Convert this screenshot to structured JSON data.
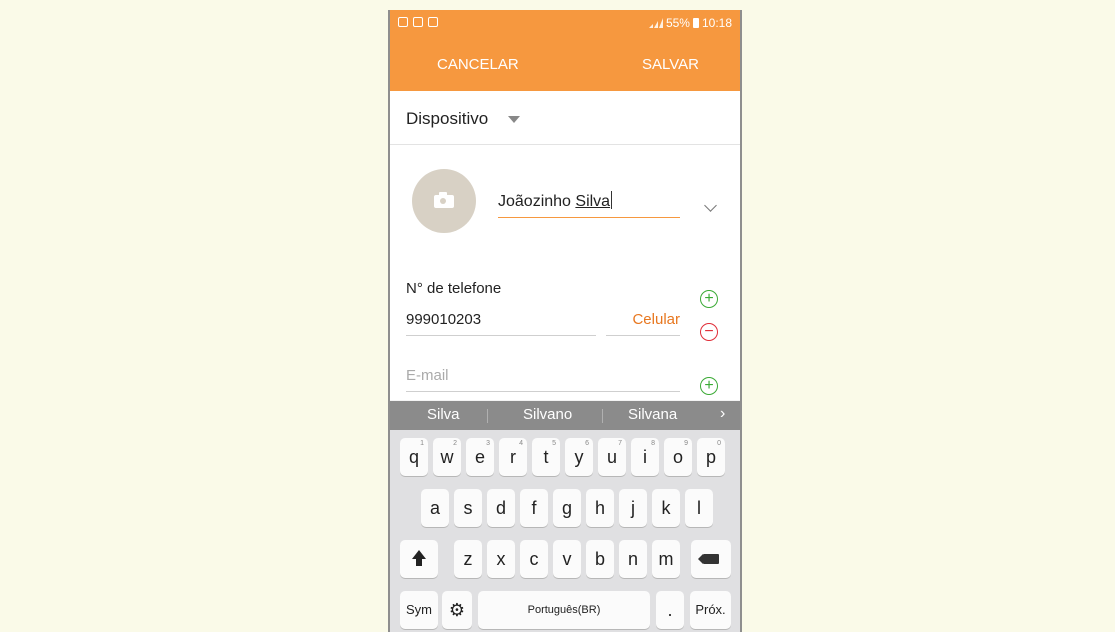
{
  "status_bar": {
    "battery": "55%",
    "time": "10:18"
  },
  "actions": {
    "cancel": "CANCELAR",
    "save": "SALVAR"
  },
  "account": {
    "label": "Dispositivo"
  },
  "contact": {
    "name_first": "Joãozinho ",
    "name_last": "Silva"
  },
  "phone": {
    "label": "N° de telefone",
    "number": "999010203",
    "type": "Celular"
  },
  "email": {
    "placeholder": "E-mail"
  },
  "suggestions": [
    "Silva",
    "Silvano",
    "Silvana"
  ],
  "keyboard": {
    "row1": [
      {
        "key": "q",
        "num": "1"
      },
      {
        "key": "w",
        "num": "2"
      },
      {
        "key": "e",
        "num": "3"
      },
      {
        "key": "r",
        "num": "4"
      },
      {
        "key": "t",
        "num": "5"
      },
      {
        "key": "y",
        "num": "6"
      },
      {
        "key": "u",
        "num": "7"
      },
      {
        "key": "i",
        "num": "8"
      },
      {
        "key": "o",
        "num": "9"
      },
      {
        "key": "p",
        "num": "0"
      }
    ],
    "row2": [
      "a",
      "s",
      "d",
      "f",
      "g",
      "h",
      "j",
      "k",
      "l"
    ],
    "row3": [
      "z",
      "x",
      "c",
      "v",
      "b",
      "n",
      "m"
    ],
    "sym": "Sym",
    "space": "Português(BR)",
    "period": ".",
    "next": "Próx."
  }
}
